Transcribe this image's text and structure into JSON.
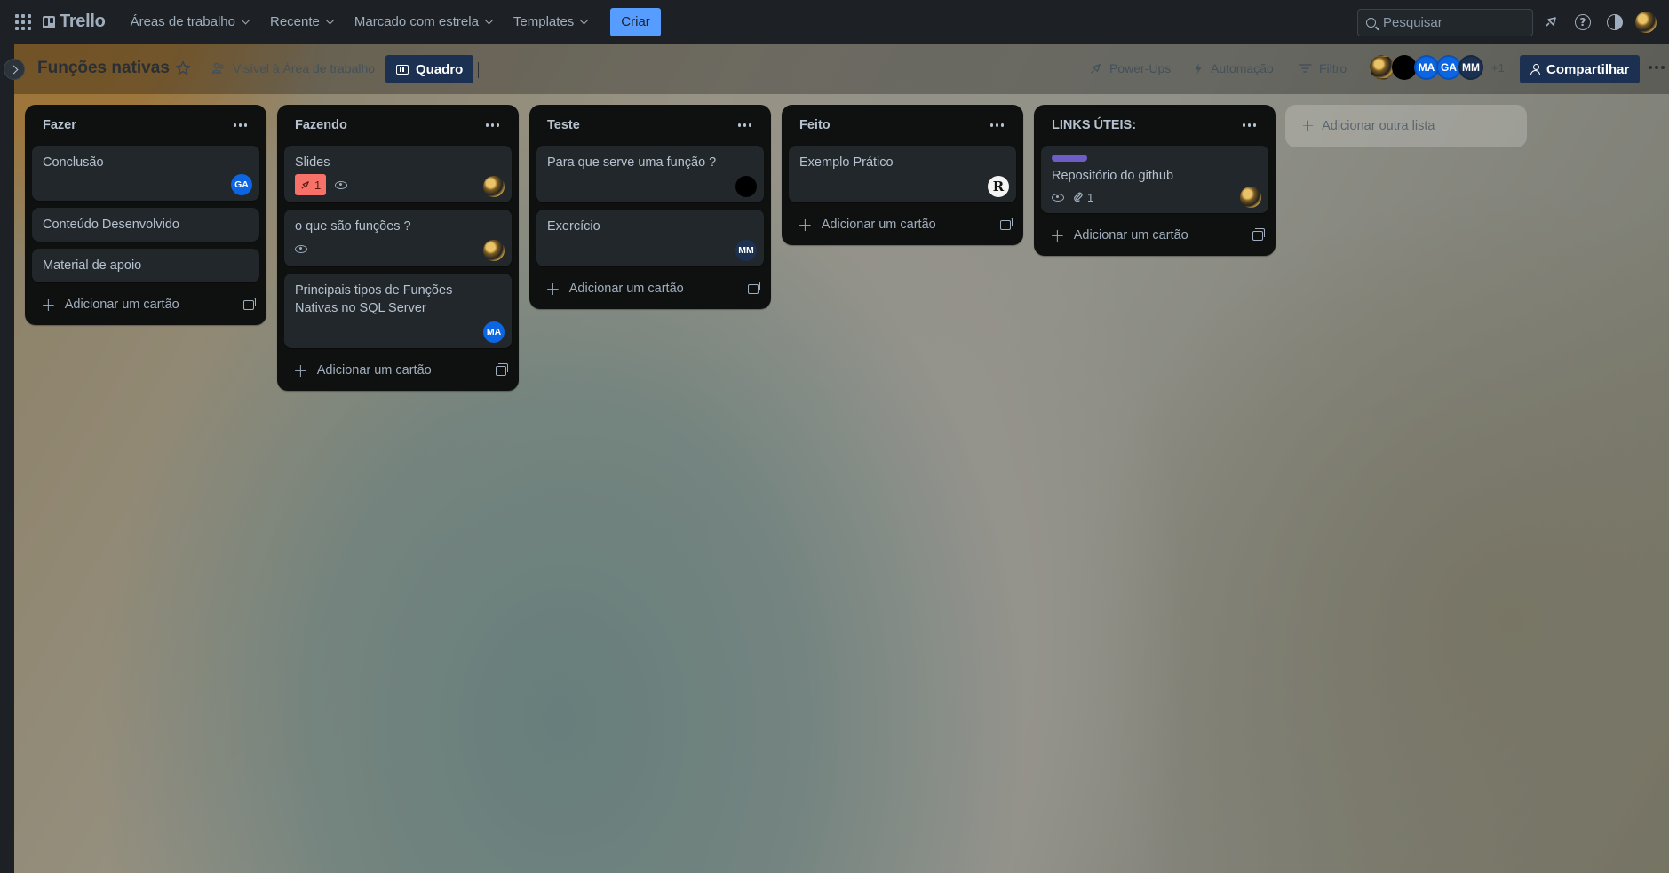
{
  "topnav": {
    "logo": "Trello",
    "menus": [
      "Áreas de trabalho",
      "Recente",
      "Marcado com estrela",
      "Templates"
    ],
    "create_label": "Criar",
    "search_placeholder": "Pesquisar",
    "icons": [
      "apps-grid-icon",
      "notifications-icon",
      "help-icon",
      "theme-icon",
      "profile-avatar"
    ]
  },
  "board": {
    "title": "Funções nativas",
    "visibility": "Visível à Área de trabalho",
    "view_label": "Quadro",
    "powerups_label": "Power-Ups",
    "automation_label": "Automação",
    "filter_label": "Filtro",
    "members": [
      "",
      "",
      "MA",
      "GA",
      "MM"
    ],
    "members_more": "+1",
    "share_label": "Compartilhar"
  },
  "colors": {
    "accent": "#579dff",
    "list_bg": "#0f1110",
    "card_bg": "#22272b",
    "label_purple": "#6e5dc6",
    "badge_red": "#f87168",
    "member_blue": "#0c66e4",
    "member_navy": "#1c3151"
  },
  "lists": [
    {
      "title": "Fazer",
      "cards": [
        {
          "title": "Conclusão",
          "member": "GA"
        },
        {
          "title": "Conteúdo Desenvolvido"
        },
        {
          "title": "Material de apoio"
        }
      ],
      "add_label": "Adicionar um cartão"
    },
    {
      "title": "Fazendo",
      "cards": [
        {
          "title": "Slides",
          "badge_count": "1"
        },
        {
          "title": "o que são funções ?"
        },
        {
          "title": "Principais tipos de Funções Nativas no SQL Server",
          "member": "MA"
        }
      ],
      "add_label": "Adicionar um cartão"
    },
    {
      "title": "Teste",
      "cards": [
        {
          "title": "Para que serve uma função ?"
        },
        {
          "title": "Exercício",
          "member": "MM"
        }
      ],
      "add_label": "Adicionar um cartão"
    },
    {
      "title": "Feito",
      "cards": [
        {
          "title": "Exemplo Prático",
          "member": "R"
        }
      ],
      "add_label": "Adicionar um cartão"
    },
    {
      "title": "LINKS ÚTEIS:",
      "cards": [
        {
          "title": "Repositório do github",
          "attachments": "1"
        }
      ],
      "add_label": "Adicionar um cartão"
    }
  ],
  "add_list_label": "Adicionar outra lista"
}
